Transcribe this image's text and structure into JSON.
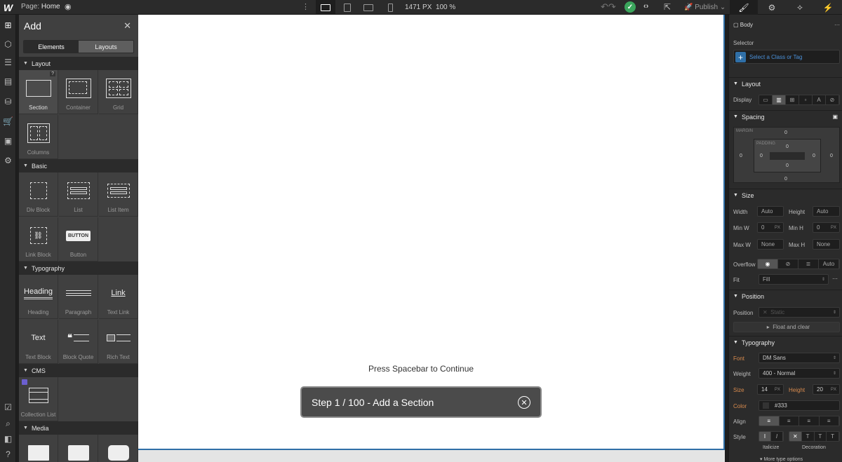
{
  "topbar": {
    "logo": "W",
    "page_prefix": "Page:",
    "page_name": "Home",
    "width_value": "1471",
    "width_unit": "PX",
    "zoom": "100 %",
    "publish_label": "Publish"
  },
  "add_panel": {
    "title": "Add",
    "tabs": [
      "Elements",
      "Layouts"
    ],
    "sections": {
      "layout": "Layout",
      "basic": "Basic",
      "typography": "Typography",
      "cms": "CMS",
      "media": "Media"
    },
    "layout_items": [
      "Section",
      "Container",
      "Grid",
      "Columns"
    ],
    "basic_items": [
      "Div Block",
      "List",
      "List Item",
      "Link Block",
      "Button"
    ],
    "button_preview": "BUTTON",
    "typography_items": [
      "Heading",
      "Paragraph",
      "Text Link",
      "Text Block",
      "Block Quote",
      "Rich Text"
    ],
    "typography_previews": {
      "heading": "Heading",
      "link": "Link",
      "text": "Text"
    },
    "cms_items": [
      "Collection List"
    ],
    "help_badge": "?"
  },
  "canvas": {
    "hint": "Press Spacebar to Continue",
    "tour_step": "Step 1 / 100 - Add a Section"
  },
  "style_panel": {
    "element": "Body",
    "selector_label": "Selector",
    "selector_placeholder": "Select a Class or Tag",
    "sections": {
      "layout": "Layout",
      "spacing": "Spacing",
      "size": "Size",
      "position": "Position",
      "typography": "Typography"
    },
    "display_label": "Display",
    "margin_label": "MARGIN",
    "padding_label": "PADDING",
    "margin": {
      "top": "0",
      "right": "0",
      "bottom": "0",
      "left": "0"
    },
    "padding": {
      "top": "0",
      "right": "0",
      "bottom": "0",
      "left": "0"
    },
    "size": {
      "width_label": "Width",
      "width": "Auto",
      "height_label": "Height",
      "height": "Auto",
      "minw_label": "Min W",
      "minw": "0",
      "minw_unit": "PX",
      "minh_label": "Min H",
      "minh": "0",
      "minh_unit": "PX",
      "maxw_label": "Max W",
      "maxw": "None",
      "maxh_label": "Max H",
      "maxh": "None",
      "overflow_label": "Overflow",
      "overflow_auto": "Auto",
      "fit_label": "Fit",
      "fit": "Fill"
    },
    "position": {
      "label": "Position",
      "value": "Static",
      "float_clear": "Float and clear"
    },
    "typography": {
      "font_label": "Font",
      "font": "DM Sans",
      "weight_label": "Weight",
      "weight": "400 - Normal",
      "size_label": "Size",
      "size": "14",
      "size_unit": "PX",
      "height_label": "Height",
      "height": "20",
      "height_unit": "PX",
      "color_label": "Color",
      "color": "#333",
      "align_label": "Align",
      "style_label": "Style",
      "italicize_label": "Italicize",
      "decoration_label": "Decoration",
      "more": "More type options"
    }
  },
  "colors": {
    "accent_blue": "#2f6fa7",
    "success_green": "#3ba55c",
    "label_orange": "#d98b4e"
  }
}
